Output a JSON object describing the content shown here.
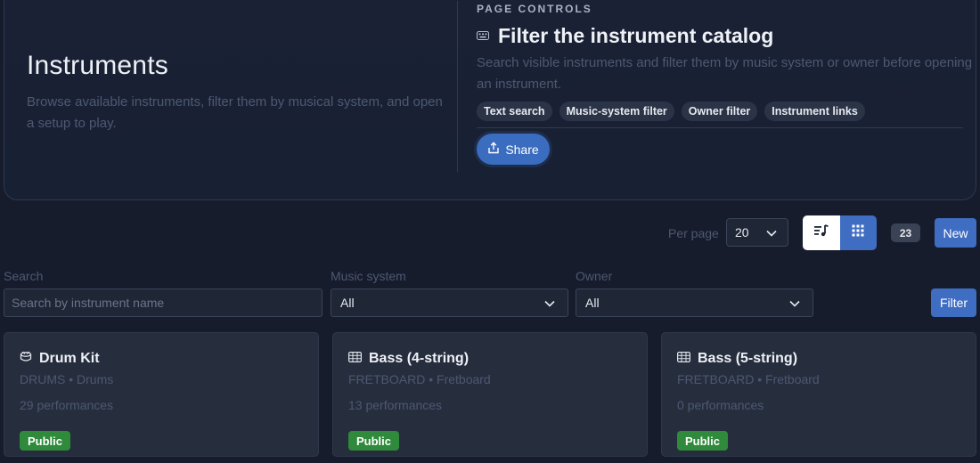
{
  "header": {
    "title": "Instruments",
    "subtitle": "Browse available instruments, filter them by musical system, and open a setup to play.",
    "controls": {
      "eyebrow": "PAGE CONTROLS",
      "title": "Filter the instrument catalog",
      "description": "Search visible instruments and filter them by music system or owner before opening an instrument.",
      "chips": [
        "Text search",
        "Music-system filter",
        "Owner filter",
        "Instrument links"
      ],
      "share_label": "Share"
    }
  },
  "toolbar": {
    "per_page_label": "Per page",
    "per_page_value": "20",
    "count": "23",
    "new_label": "New"
  },
  "filters": {
    "search_label": "Search",
    "search_placeholder": "Search by instrument name",
    "music_system_label": "Music system",
    "music_system_value": "All",
    "owner_label": "Owner",
    "owner_value": "All",
    "filter_label": "Filter"
  },
  "cards": [
    {
      "icon": "drum-icon",
      "title": "Drum Kit",
      "meta": "DRUMS • Drums",
      "performances": "29 performances",
      "badge": "Public"
    },
    {
      "icon": "fretboard-icon",
      "title": "Bass (4-string)",
      "meta": "FRETBOARD • Fretboard",
      "performances": "13 performances",
      "badge": "Public"
    },
    {
      "icon": "fretboard-icon",
      "title": "Bass (5-string)",
      "meta": "FRETBOARD • Fretboard",
      "performances": "0 performances",
      "badge": "Public"
    }
  ],
  "colors": {
    "accent": "#3f6dc2",
    "public_badge": "#2f8a3c",
    "background": "#161c2b",
    "card": "#262d3d"
  }
}
